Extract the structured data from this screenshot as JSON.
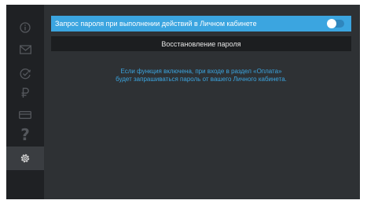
{
  "sidebar": {
    "items": [
      {
        "icon": "info-icon"
      },
      {
        "icon": "mail-icon"
      },
      {
        "icon": "refresh-check-icon"
      },
      {
        "icon": "ruble-icon"
      },
      {
        "icon": "card-icon"
      },
      {
        "icon": "question-icon",
        "glyph": "?"
      },
      {
        "icon": "gear-icon",
        "active": true
      }
    ]
  },
  "settings": {
    "password_toggle_label": "Запрос пароля при выполнении действий в Личном кабинете",
    "password_toggle_on": false,
    "reset_button_label": "Восстановление пароля",
    "hint_line1": "Если функция включена, при входе в раздел «Оплата»",
    "hint_line2": "будет запрашиваться пароль от вашего Личного кабинета."
  },
  "colors": {
    "accent": "#3ba5e0",
    "background": "#2e3134",
    "sidebar": "#1f2124",
    "button": "#1c1e20",
    "icon": "#54575c",
    "icon_active": "#d0d0d0"
  }
}
